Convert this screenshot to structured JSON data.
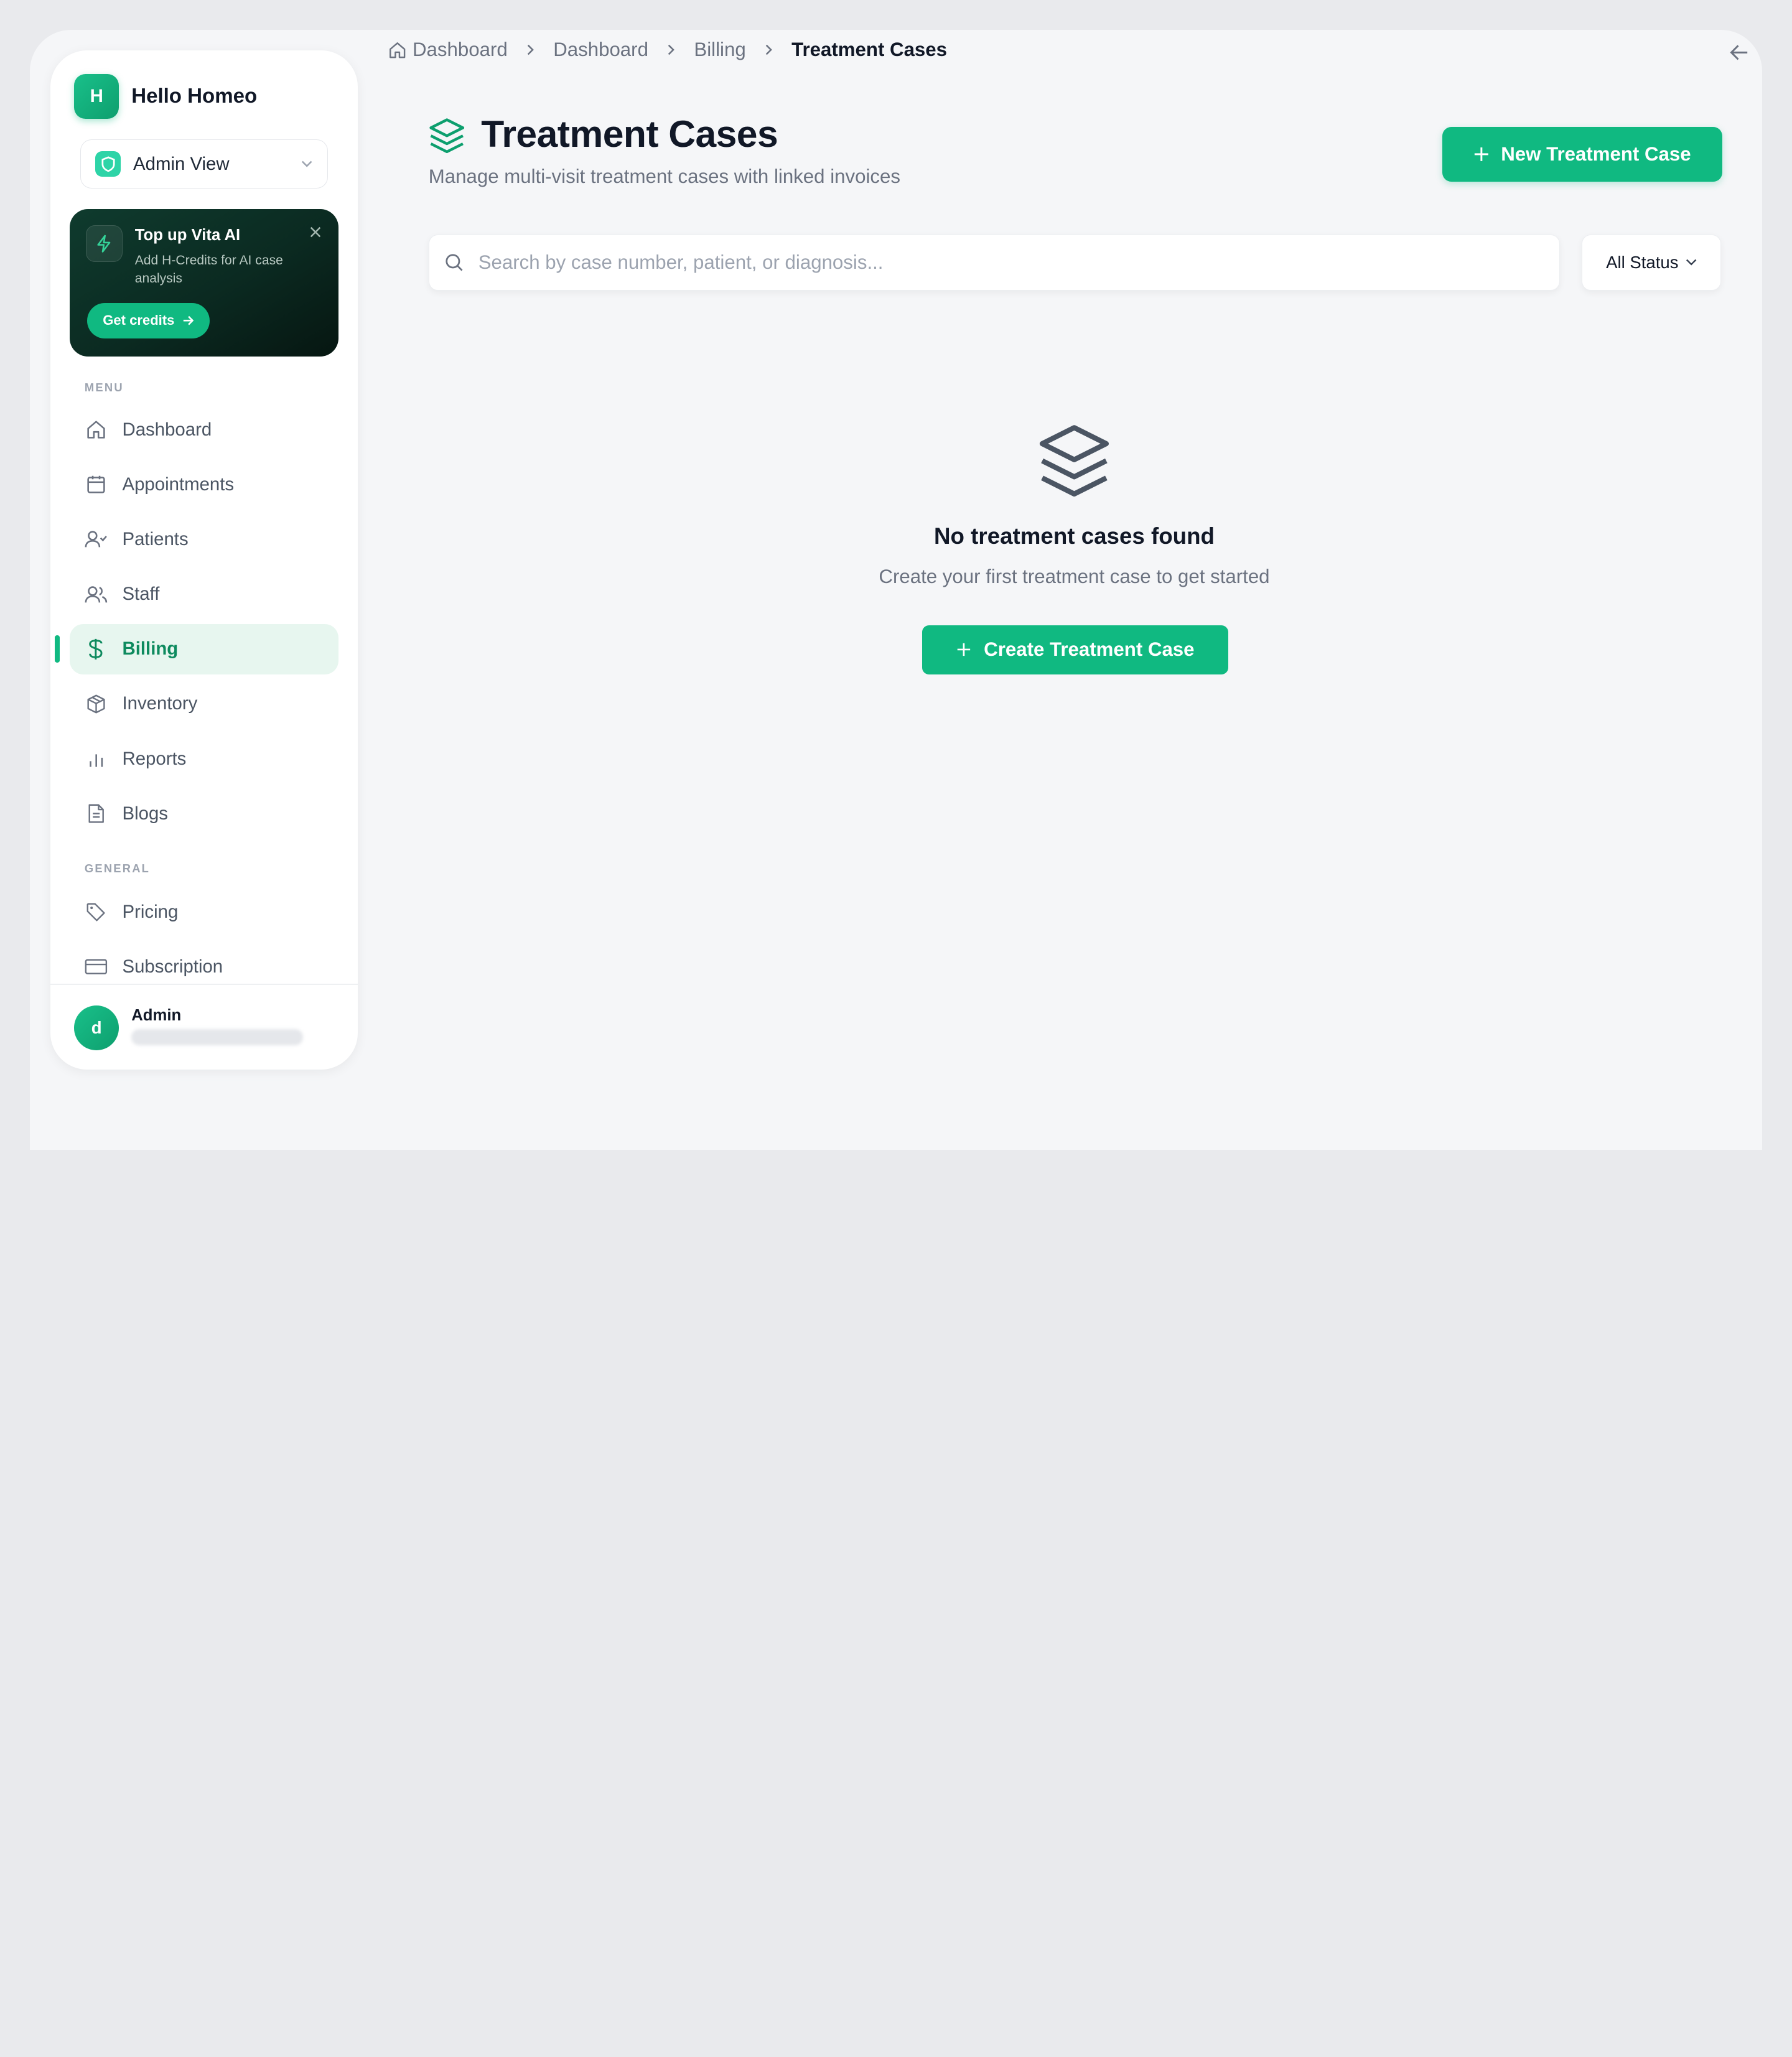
{
  "app": {
    "name": "Hello Homeo",
    "logo_letter": "H"
  },
  "view_selector": {
    "value": "Admin View"
  },
  "promo": {
    "title": "Top up Vita AI",
    "description": "Add H-Credits for AI case analysis",
    "button_label": "Get credits"
  },
  "sidebar": {
    "menu_label": "MENU",
    "general_label": "GENERAL",
    "items": [
      {
        "label": "Dashboard",
        "icon": "home-icon"
      },
      {
        "label": "Appointments",
        "icon": "calendar-icon"
      },
      {
        "label": "Patients",
        "icon": "user-check-icon"
      },
      {
        "label": "Staff",
        "icon": "users-icon"
      },
      {
        "label": "Billing",
        "icon": "dollar-icon",
        "active": true
      },
      {
        "label": "Inventory",
        "icon": "package-icon"
      },
      {
        "label": "Reports",
        "icon": "bar-chart-icon"
      },
      {
        "label": "Blogs",
        "icon": "file-text-icon"
      }
    ],
    "general_items": [
      {
        "label": "Pricing",
        "icon": "tag-icon"
      },
      {
        "label": "Subscription",
        "icon": "credit-card-icon"
      }
    ]
  },
  "user": {
    "initial": "d",
    "name": "Admin"
  },
  "breadcrumb": [
    "Dashboard",
    "Dashboard",
    "Billing",
    "Treatment Cases"
  ],
  "header": {
    "title": "Treatment Cases",
    "subtitle": "Manage multi-visit treatment cases with linked invoices",
    "new_button": "New Treatment Case"
  },
  "search": {
    "placeholder": "Search by case number, patient, or diagnosis...",
    "value": ""
  },
  "status_filter": {
    "value": "All Status"
  },
  "empty_state": {
    "title": "No treatment cases found",
    "description": "Create your first treatment case to get started",
    "button": "Create Treatment Case"
  },
  "colors": {
    "accent": "#10b981",
    "active_bg": "#e7f6ef",
    "promo_bg": "#0b2a21"
  }
}
